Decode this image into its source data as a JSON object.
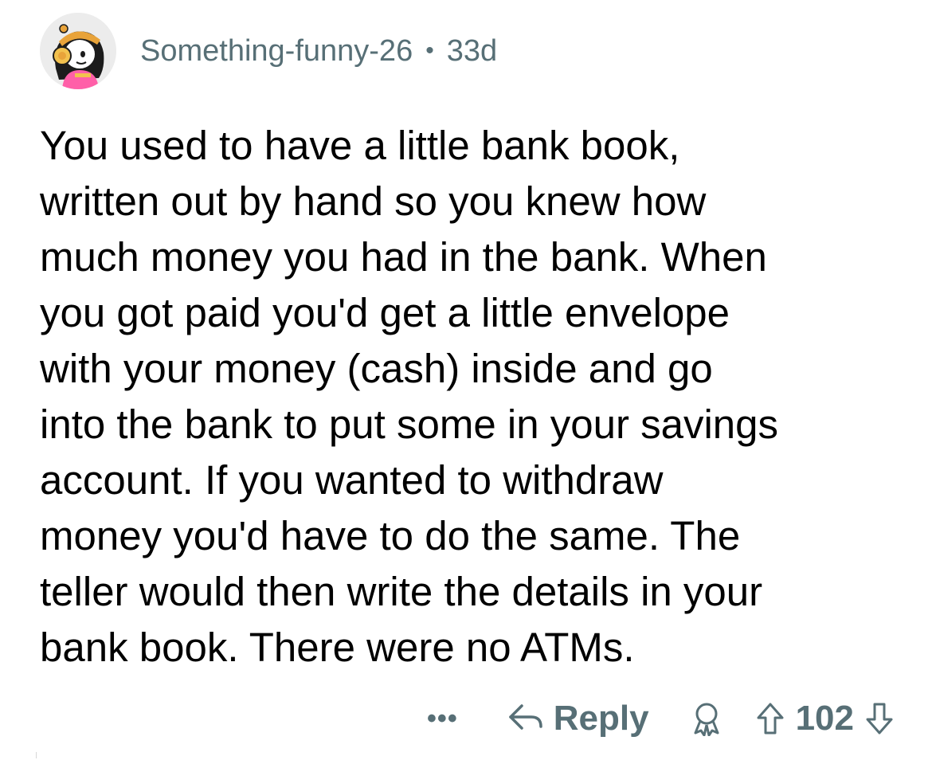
{
  "comment": {
    "username": "Something-funny-26",
    "separator": "•",
    "age": "33d",
    "body_lines": [
      "You used to have a little bank book,",
      "written out by hand so you knew how",
      "much money you had in the bank. When",
      "you got paid you'd get a little envelope",
      "with your money (cash) inside and go",
      "into the bank to put some in your savings",
      "account. If you wanted to withdraw",
      "money you'd have to do the same. The",
      "teller would then write the details in your",
      "bank book. There were no ATMs."
    ]
  },
  "actions": {
    "more_label": "•••",
    "reply_label": "Reply",
    "score": "102"
  },
  "icons": {
    "more": "more-options-icon",
    "reply": "reply-arrow-icon",
    "award": "award-icon",
    "upvote": "upvote-arrow-icon",
    "downvote": "downvote-arrow-icon"
  },
  "colors": {
    "meta_text": "#576f76",
    "body_text": "#000000",
    "background": "#ffffff"
  }
}
